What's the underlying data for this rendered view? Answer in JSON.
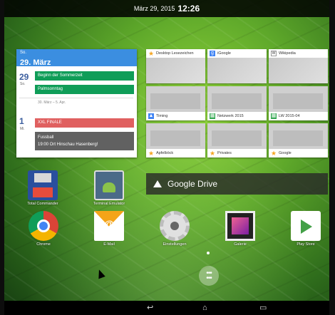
{
  "status_bar": {
    "date": "März 29, 2015",
    "time": "12:26"
  },
  "calendar": {
    "header_dow": "So.",
    "header_date": "29. März",
    "day1_num": "29",
    "day1_dow": "So.",
    "events_day1": [
      "Beginn der Sommerzeit",
      "Palmsonntag"
    ],
    "range": "30. März – 5. Apr.",
    "day2_num": "1",
    "day2_dow": "Mi.",
    "event_red": "XXL FINALE",
    "event_gray_title": "Fussball",
    "event_gray_sub": "19:00 Ort Hinschau Hasenberg!"
  },
  "bookmarks": [
    {
      "label": "Desktop Lesezeichen",
      "icon": "star-icon"
    },
    {
      "label": "iGoogle",
      "icon": "google-icon"
    },
    {
      "label": "Wikipedia",
      "icon": "wikipedia-icon"
    },
    {
      "label": "Timing",
      "icon": "drive-icon"
    },
    {
      "label": "Netzwerk 2015",
      "icon": "sheets-icon"
    },
    {
      "label": "LW 2015-04",
      "icon": "sheets-icon"
    },
    {
      "label": "Apfelböck",
      "icon": "star-icon"
    },
    {
      "label": "Privates",
      "icon": "star-icon"
    },
    {
      "label": "Google",
      "icon": "star-icon"
    }
  ],
  "gdrive": {
    "label": "Google Drive"
  },
  "apps_row1": [
    {
      "name": "Total Commander",
      "icon": "floppy-icon"
    },
    {
      "name": "Terminal Emulator",
      "icon": "android-icon"
    }
  ],
  "apps_row2": [
    {
      "name": "Chrome",
      "icon": "chrome-icon"
    },
    {
      "name": "E-Mail",
      "icon": "email-icon"
    },
    {
      "name": "Einstellungen",
      "icon": "gear-icon"
    },
    {
      "name": "Galerie",
      "icon": "gallery-icon"
    },
    {
      "name": "Play Store",
      "icon": "play-store-icon"
    }
  ],
  "nav": {
    "back": "↩",
    "home": "⌂",
    "recents": "▭"
  },
  "colors": {
    "calendar_accent": "#3b8ee0",
    "event_green": "#0f9d58",
    "event_red": "#e06060"
  }
}
